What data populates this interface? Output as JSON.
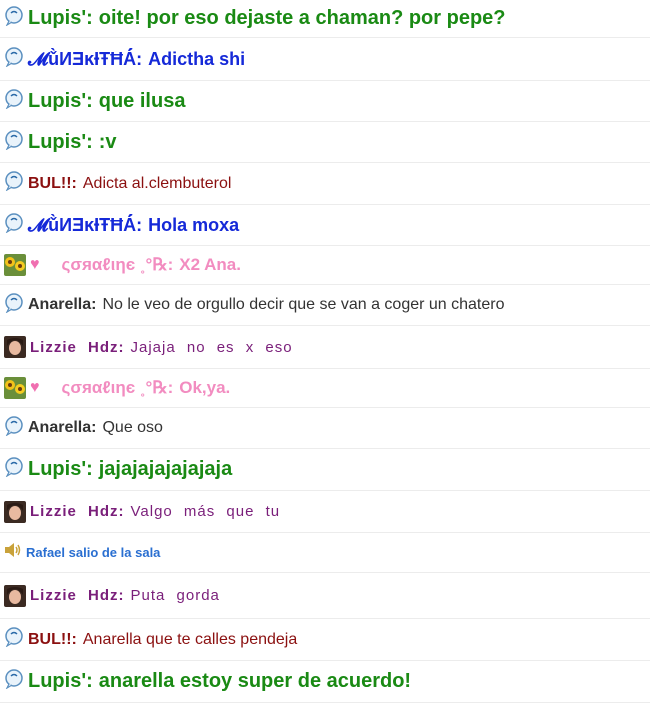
{
  "messages": [
    {
      "type": "bubble",
      "nick": "Lupis':",
      "text": "oite! por eso dejaste a chaman? por pepe?"
    },
    {
      "type": "bubble",
      "nick": "𝓜ǔ̀ИƎĸƗŦĦÁ́:",
      "text": "Adictha shi"
    },
    {
      "type": "bubble",
      "nick": "Lupis':",
      "text": "que ilusa"
    },
    {
      "type": "bubble",
      "nick": "Lupis':",
      "text": ":v"
    },
    {
      "type": "bubble",
      "nick": "BUL!!:",
      "text": "Adicta al.clembuterol"
    },
    {
      "type": "bubble",
      "nick": "𝓜ǔ̀ИƎĸƗŦĦÁ́:",
      "text": "Hola moxa"
    },
    {
      "type": "flower",
      "nick": "ςσяαℓιηє ˳°℞:",
      "text": "X2 Ana."
    },
    {
      "type": "bubble",
      "nick": "Anarella:",
      "text": "No le veo de orgullo decir que se van a coger un chatero"
    },
    {
      "type": "photo",
      "nick": "Lizzie Hdz:",
      "text": "Jajaja no es x eso"
    },
    {
      "type": "flower",
      "nick": "ςσяαℓιηє ˳°℞:",
      "text": "Ok,ya."
    },
    {
      "type": "bubble",
      "nick": "Anarella:",
      "text": "Que oso"
    },
    {
      "type": "bubble",
      "nick": "Lupis':",
      "text": "jajajajajajajaja"
    },
    {
      "type": "photo",
      "nick": "Lizzie Hdz:",
      "text": "Valgo más que tu"
    },
    {
      "type": "system",
      "text": "Rafael salio de la sala"
    },
    {
      "type": "photo",
      "nick": "Lizzie Hdz:",
      "text": "Puta gorda"
    },
    {
      "type": "bubble",
      "nick": "BUL!!:",
      "text": "Anarella que te calles pendeja"
    },
    {
      "type": "bubble",
      "nick": "Lupis':",
      "text": "anarella estoy super de acuerdo!"
    }
  ],
  "icons": {
    "bubble": "speech-bubble-icon",
    "photo": "user-avatar",
    "flower": "sunflower-avatar",
    "heart": "heart-icon",
    "speaker": "speaker-icon"
  },
  "colors": {
    "green": "#1a8a14",
    "blue": "#1529d8",
    "pink": "#f28cc0",
    "darkred": "#8b1010",
    "gray": "#333333",
    "purple": "#7a1f7a",
    "system": "#2a6fd1"
  }
}
